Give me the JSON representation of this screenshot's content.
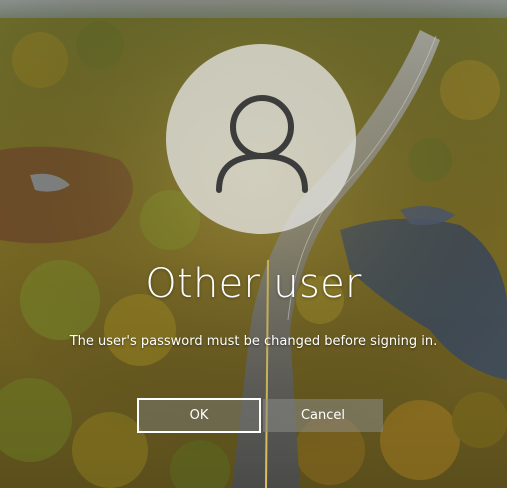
{
  "screen": "lock-screen-dialog",
  "user": {
    "name": "Other user",
    "avatar_icon": "user-silhouette-icon"
  },
  "message": "The user's password must be changed before signing in.",
  "buttons": {
    "ok_label": "OK",
    "cancel_label": "Cancel"
  },
  "colors": {
    "text": "#ffffff",
    "avatar_bg": "#e1e1de",
    "avatar_glyph": "#3c3c3c"
  }
}
